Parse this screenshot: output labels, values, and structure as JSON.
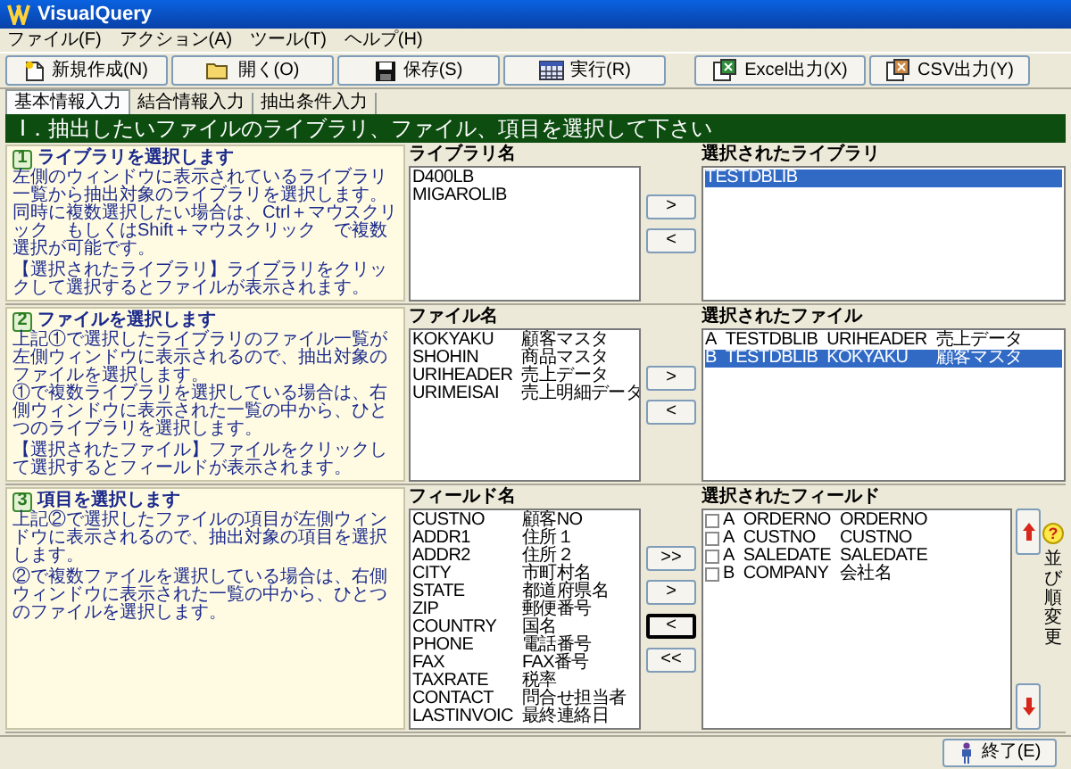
{
  "window": {
    "title": "VisualQuery"
  },
  "menu": [
    "ファイル(F)",
    "アクション(A)",
    "ツール(T)",
    "ヘルプ(H)"
  ],
  "toolbar": [
    {
      "label": "新規作成(N)",
      "kind": "new"
    },
    {
      "label": "開く(O)",
      "kind": "open"
    },
    {
      "label": "保存(S)",
      "kind": "save"
    },
    {
      "label": "実行(R)",
      "kind": "run"
    },
    {
      "label": "Excel出力(X)",
      "kind": "excel"
    },
    {
      "label": "CSV出力(Y)",
      "kind": "csv"
    }
  ],
  "tabs": [
    {
      "label": "基本情報入力",
      "selected": true
    },
    {
      "label": "結合情報入力",
      "selected": false
    },
    {
      "label": "抽出条件入力",
      "selected": false
    }
  ],
  "banner": "Ⅰ．抽出したいファイルのライブラリ、ファイル、項目を選択して下さい",
  "sections": [
    {
      "badge": "1",
      "title": "ライブラリを選択します",
      "help": [
        [
          "左側のウィンドウに表示されているライブラリ一覧から抽出対象のライブラリを選択します。",
          "同時に複数選択したい場合は、Ctrl＋マウスクリック　もしくはShift＋マウスクリック　で複数選択が可能です。"
        ],
        [
          "【選択されたライブラリ】ライブラリをクリックして選択するとファイルが表示されます。"
        ]
      ],
      "source": {
        "heading": "ライブラリ名",
        "items": [
          {
            "cells": [
              "D400LB"
            ],
            "selected": false
          },
          {
            "cells": [
              "MIGAROLIB"
            ],
            "selected": false
          }
        ]
      },
      "buttons": [
        {
          "label": ">",
          "focused": false
        },
        {
          "label": "<",
          "focused": false
        }
      ],
      "target": {
        "heading": "選択されたライブラリ",
        "items": [
          {
            "cells": [
              "TESTDBLIB"
            ],
            "selected": true
          }
        ]
      }
    },
    {
      "badge": "2",
      "title": "ファイルを選択します",
      "help": [
        [
          "上記①で選択したライブラリのファイル一覧が左側ウィンドウに表示されるので、抽出対象のファイルを選択します。",
          "①で複数ライブラリを選択している場合は、右側ウィンドウに表示された一覧の中から、ひとつのライブラリを選択します。"
        ],
        [
          "【選択されたファイル】ファイルをクリックして選択するとフィールドが表示されます。"
        ]
      ],
      "source": {
        "heading": "ファイル名",
        "items": [
          {
            "cells": [
              "KOKYAKU",
              "顧客マスタ"
            ],
            "selected": false
          },
          {
            "cells": [
              "SHOHIN",
              "商品マスタ"
            ],
            "selected": false
          },
          {
            "cells": [
              "URIHEADER",
              "売上データ"
            ],
            "selected": false
          },
          {
            "cells": [
              "URIMEISAI",
              "売上明細データ"
            ],
            "selected": false
          }
        ]
      },
      "buttons": [
        {
          "label": ">",
          "focused": false
        },
        {
          "label": "<",
          "focused": false
        }
      ],
      "target": {
        "heading": "選択されたファイル",
        "items": [
          {
            "cells": [
              "A",
              "TESTDBLIB",
              "URIHEADER",
              "売上データ"
            ],
            "selected": false
          },
          {
            "cells": [
              "B",
              "TESTDBLIB",
              "KOKYAKU",
              "顧客マスタ"
            ],
            "selected": true
          }
        ]
      }
    },
    {
      "badge": "3",
      "title": "項目を選択します",
      "help": [
        [
          "上記②で選択したファイルの項目が左側ウィンドウに表示されるので、抽出対象の項目を選択します。"
        ],
        [
          "②で複数ファイルを選択している場合は、右側ウィンドウに表示された一覧の中から、ひとつのファイルを選択します。"
        ]
      ],
      "source": {
        "heading": "フィールド名",
        "items": [
          {
            "cells": [
              "CUSTNO",
              "顧客NO"
            ],
            "selected": false
          },
          {
            "cells": [
              "ADDR1",
              "住所１"
            ],
            "selected": false
          },
          {
            "cells": [
              "ADDR2",
              "住所２"
            ],
            "selected": false
          },
          {
            "cells": [
              "CITY",
              "市町村名"
            ],
            "selected": false
          },
          {
            "cells": [
              "STATE",
              "都道府県名"
            ],
            "selected": false
          },
          {
            "cells": [
              "ZIP",
              "郵便番号"
            ],
            "selected": false
          },
          {
            "cells": [
              "COUNTRY",
              "国名"
            ],
            "selected": false
          },
          {
            "cells": [
              "PHONE",
              "電話番号"
            ],
            "selected": false
          },
          {
            "cells": [
              "FAX",
              "FAX番号"
            ],
            "selected": false
          },
          {
            "cells": [
              "TAXRATE",
              "税率"
            ],
            "selected": false
          },
          {
            "cells": [
              "CONTACT",
              "問合せ担当者"
            ],
            "selected": false
          },
          {
            "cells": [
              "LASTINVOIC",
              "最終連絡日"
            ],
            "selected": false
          }
        ]
      },
      "buttons": [
        {
          "label": ">>",
          "focused": false
        },
        {
          "label": ">",
          "focused": false
        },
        {
          "label": "<",
          "focused": true
        },
        {
          "label": "<<",
          "focused": false
        }
      ],
      "target": {
        "heading": "選択されたフィールド",
        "items": [
          {
            "cells": [
              "A",
              "ORDERNO",
              "ORDERNO"
            ],
            "selected": false,
            "checked": false
          },
          {
            "cells": [
              "A",
              "CUSTNO",
              "CUSTNO"
            ],
            "selected": false,
            "checked": false
          },
          {
            "cells": [
              "A",
              "SALEDATE",
              "SALEDATE"
            ],
            "selected": false,
            "checked": false
          },
          {
            "cells": [
              "B",
              "COMPANY",
              "会社名"
            ],
            "selected": false,
            "checked": false
          }
        ]
      },
      "sort": {
        "label": "並び順変更",
        "help_glyph": "?"
      }
    }
  ],
  "exit_button": "終了(E)"
}
